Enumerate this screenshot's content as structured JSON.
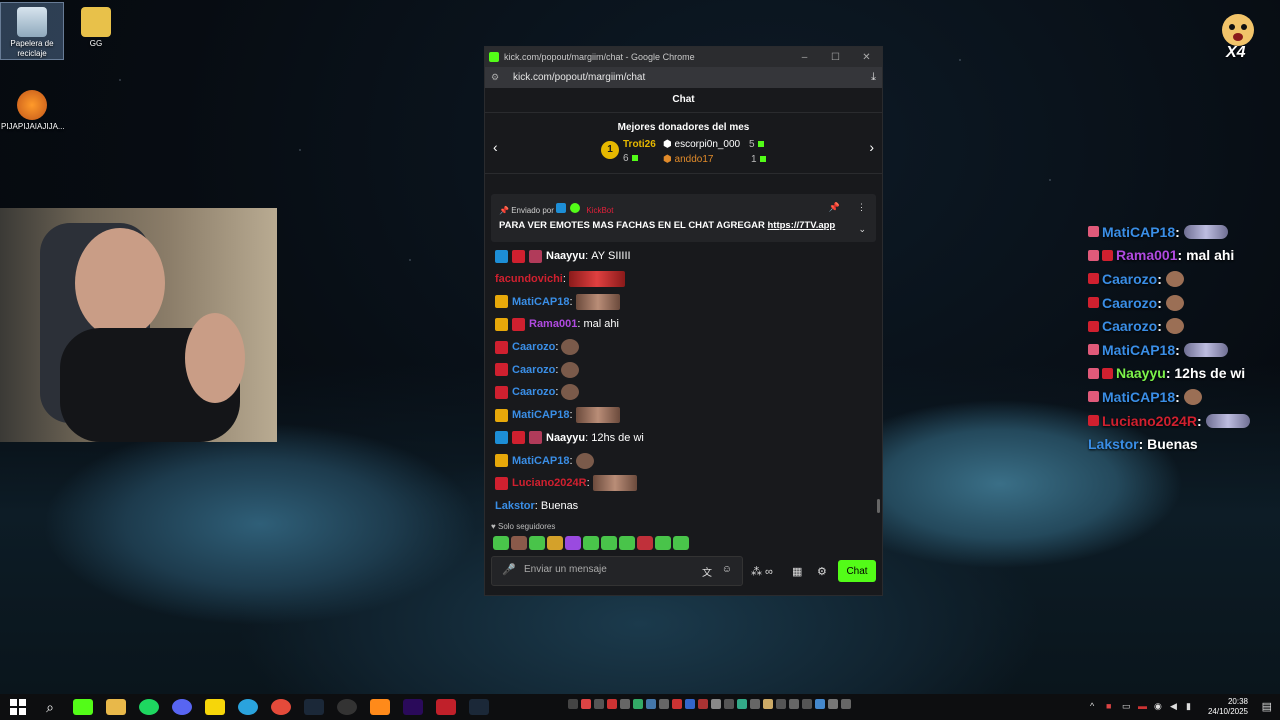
{
  "desktop": {
    "icons": [
      {
        "label": "Papelera de reciclaje"
      },
      {
        "label": "GG"
      },
      {
        "label": "PIJAPIJAIAJIJA..."
      }
    ],
    "badge": "X4"
  },
  "window": {
    "title": "kick.com/popout/margiim/chat - Google Chrome",
    "url": "kick.com/popout/margiim/chat",
    "chat_header": "Chat",
    "donors": {
      "title": "Mejores donadores del mes",
      "rank1": "1",
      "first": {
        "name": "Troti26",
        "amount": "6"
      },
      "second": {
        "name": "escorpi0n_000",
        "amount": "5"
      },
      "third": {
        "name": "anddo17",
        "amount": "1"
      }
    },
    "pinned": {
      "sent_by": "Enviado por",
      "bot": "KickBot",
      "text": "PARA VER EMOTES MAS FACHAS EN EL CHAT AGREGAR",
      "link": "https://7TV.app"
    },
    "messages": [
      {
        "user": "Naayyu",
        "color": "#3a8ee6",
        "text": "AY SIIIII"
      },
      {
        "user": "facundovichi",
        "color": "#d0202f",
        "text": ""
      },
      {
        "user": "MatiCAP18",
        "color": "#3a8ee6",
        "text": ""
      },
      {
        "user": "Rama001",
        "color": "#b04ae0",
        "text": "mal ahi"
      },
      {
        "user": "Caarozo",
        "color": "#3a8ee6",
        "text": ""
      },
      {
        "user": "Caarozo",
        "color": "#3a8ee6",
        "text": ""
      },
      {
        "user": "Caarozo",
        "color": "#3a8ee6",
        "text": ""
      },
      {
        "user": "MatiCAP18",
        "color": "#3a8ee6",
        "text": ""
      },
      {
        "user": "Naayyu",
        "color": "#3a8ee6",
        "text": "12hs de wi"
      },
      {
        "user": "MatiCAP18",
        "color": "#3a8ee6",
        "text": ""
      },
      {
        "user": "Luciano2024R",
        "color": "#d0202f",
        "text": ""
      },
      {
        "user": "Lakstor",
        "color": "#3a8ee6",
        "text": "Buenas"
      }
    ],
    "mode": "Solo seguidores",
    "input_placeholder": "Enviar un mensaje",
    "send_label": "Chat"
  },
  "overlay": [
    {
      "user": "MatiCAP18",
      "text": ""
    },
    {
      "user": "Rama001",
      "text": "mal ahi"
    },
    {
      "user": "Caarozo",
      "text": ""
    },
    {
      "user": "Caarozo",
      "text": ""
    },
    {
      "user": "Caarozo",
      "text": ""
    },
    {
      "user": "MatiCAP18",
      "text": ""
    },
    {
      "user": "Naayyu",
      "text": "12hs de wi"
    },
    {
      "user": "MatiCAP18",
      "text": ""
    },
    {
      "user": "Luciano2024R",
      "text": ""
    },
    {
      "user": "Lakstor",
      "text": "Buenas"
    }
  ],
  "taskbar": {
    "time": "20:38",
    "date": "24/10/2025"
  },
  "colors": {
    "kick_green": "#53fc18",
    "name_blue": "#3a8ee6",
    "name_purple": "#b04ae0",
    "name_red": "#d0202f",
    "name_green": "#7cf24a"
  }
}
